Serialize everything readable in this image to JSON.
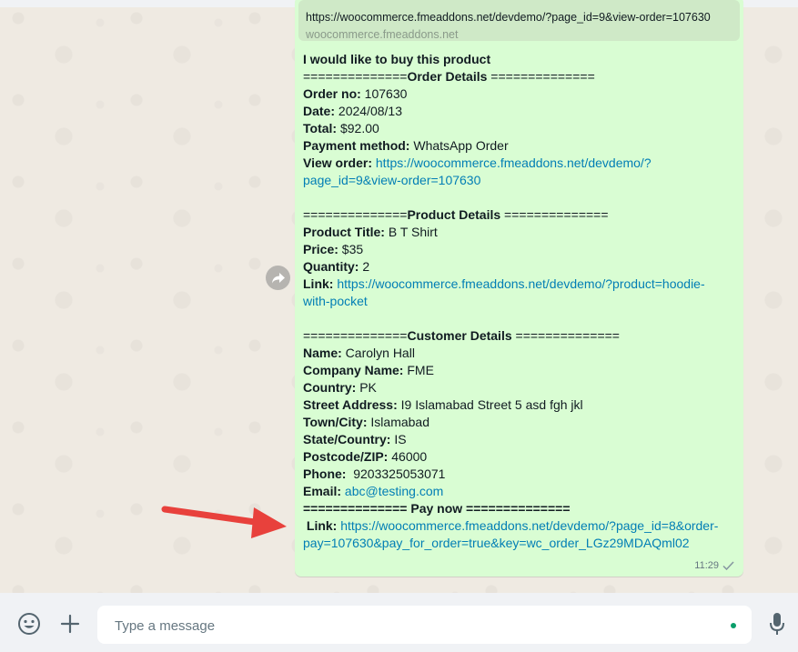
{
  "preview": {
    "url": "https://woocommerce.fmeaddons.net/devdemo/?page_id=9&view-order=107630",
    "domain": "woocommerce.fmeaddons.net"
  },
  "message": {
    "intro": "I would like to buy this product",
    "order_header_left": "==============",
    "order_header_title": "Order Details",
    "order_header_right": " ==============",
    "order_no_label": "Order no:",
    "order_no": " 107630",
    "date_label": "Date:",
    "date": " 2024/08/13",
    "total_label": "Total:",
    "total": " $92.00",
    "payment_label": "Payment method:",
    "payment": " WhatsApp Order",
    "view_order_label": "View order:",
    "view_order_link_1": "https://woocommerce.fmeaddons.net/devdemo/?",
    "view_order_link_2": "page_id=9&view-order=107630",
    "product_header_left": "==============",
    "product_header_title": "Product Details",
    "product_header_right": " ==============",
    "product_title_label": "Product Title:",
    "product_title": " B T Shirt",
    "price_label": "Price:",
    "price": " $35",
    "quantity_label": "Quantity:",
    "quantity": " 2",
    "product_link_label": "Link:",
    "product_link_1": "https://woocommerce.fmeaddons.net/devdemo/?product=hoodie-",
    "product_link_2": "with-pocket",
    "customer_header_left": "==============",
    "customer_header_title": "Customer Details",
    "customer_header_right": " ==============",
    "name_label": "Name:",
    "name": " Carolyn Hall",
    "company_label": "Company Name:",
    "company": " FME",
    "country_label": "Country:",
    "country": " PK",
    "street_label": "Street Address:",
    "street": " I9 Islamabad Street 5 asd fgh jkl",
    "town_label": "Town/City:",
    "town": " Islamabad",
    "state_label": "State/Country:",
    "state": " IS",
    "postcode_label": "Postcode/ZIP:",
    "postcode": " 46000",
    "phone_label": "Phone:",
    "phone": "  9203325053071",
    "email_label": "Email:",
    "email": "abc@testing.com",
    "paynow_header": "============== Pay now ==============",
    "pay_link_label": " Link:",
    "pay_link_1": "https://woocommerce.fmeaddons.net/devdemo/?page_id=8&order-",
    "pay_link_2": "pay=107630&pay_for_order=true&key=wc_order_LGz29MDAQml02",
    "time": "11:29"
  },
  "composer": {
    "placeholder": "Type a message"
  },
  "icons": {
    "forward": "forward-icon",
    "checkmark": "single-check-icon",
    "emoji": "emoji-icon",
    "attach": "plus-icon",
    "mic": "microphone-icon"
  },
  "colors": {
    "bubble": "#d9fdd3",
    "link": "#027eb5",
    "annotation_arrow": "#e8413c",
    "background": "#efeae2"
  }
}
